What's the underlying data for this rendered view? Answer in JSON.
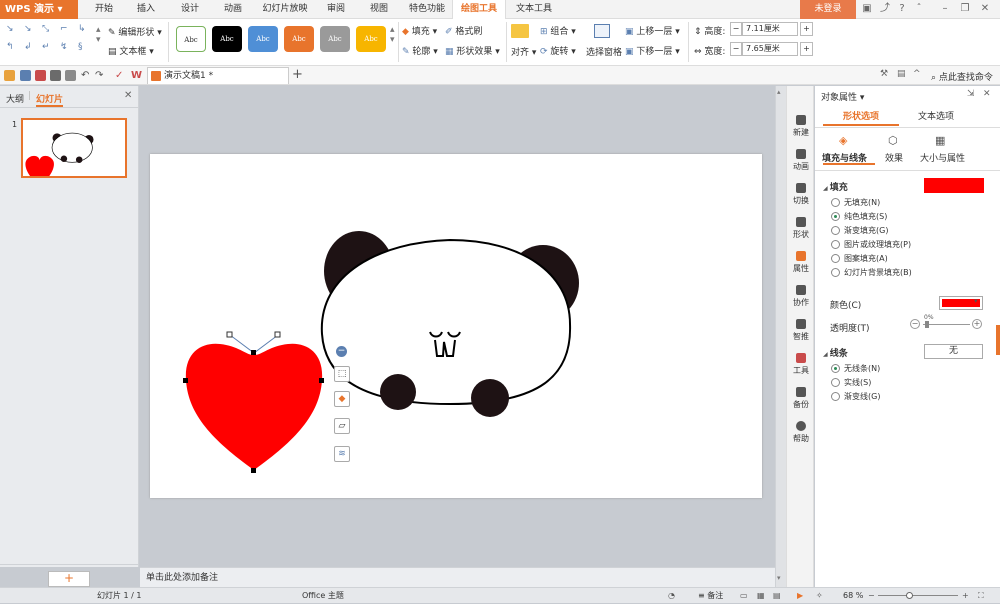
{
  "app": {
    "logo": "WPS 演示",
    "login": "未登录"
  },
  "menu": [
    "开始",
    "插入",
    "设计",
    "动画",
    "幻灯片放映",
    "审阅",
    "视图",
    "特色功能",
    "绘图工具",
    "文本工具"
  ],
  "ribbon": {
    "edit_shape": "编辑形状",
    "text_box": "文本框",
    "styles": [
      "Abc",
      "Abc",
      "Abc",
      "Abc",
      "Abc",
      "Abc"
    ],
    "fill": "填充",
    "outline": "轮廓",
    "format_painter": "格式刷",
    "shape_effects": "形状效果",
    "align": "对齐",
    "group": "组合",
    "rotate": "旋转",
    "selection_pane": "选择窗格",
    "bring_forward": "上移一层",
    "send_backward": "下移一层",
    "height_label": "高度:",
    "height_value": "7.11厘米",
    "width_label": "宽度:",
    "width_value": "7.65厘米"
  },
  "quickaccess": {
    "doc_tab": "演示文稿1 *",
    "search": "点此查找命令"
  },
  "left_pane": {
    "outline_tab": "大纲",
    "slides_tab": "幻灯片",
    "slide_number": "1"
  },
  "notes_placeholder": "单击此处添加备注",
  "status": {
    "slide_info": "幻灯片 1 / 1",
    "theme": "Office 主题",
    "notes": "备注",
    "zoom": "68 %"
  },
  "sidebar": [
    "新建",
    "动画",
    "切换",
    "形状",
    "属性",
    "协作",
    "智推",
    "工具",
    "备份",
    "帮助"
  ],
  "props": {
    "title": "对象属性",
    "tab_shape": "形状选项",
    "tab_text": "文本选项",
    "sub_fill_line": "填充与线条",
    "sub_effects": "效果",
    "sub_size": "大小与属性",
    "fill_section": "填充",
    "fill_options": [
      "无填充(N)",
      "纯色填充(S)",
      "渐变填充(G)",
      "图片或纹理填充(P)",
      "图案填充(A)",
      "幻灯片背景填充(B)"
    ],
    "color_label": "颜色(C)",
    "transparency_label": "透明度(T)",
    "transparency_value": "0%",
    "line_section": "线条",
    "line_value": "无",
    "line_options": [
      "无线条(N)",
      "实线(S)",
      "渐变线(G)"
    ]
  },
  "colors": {
    "accent": "#e8742c",
    "fill": "#ff0000",
    "selected_fill_option": 1,
    "selected_line_option": 0
  },
  "style_colors": [
    "#ffffff",
    "#000000",
    "#4f8fd6",
    "#e8742c",
    "#9a9a9a",
    "#f7b500"
  ]
}
